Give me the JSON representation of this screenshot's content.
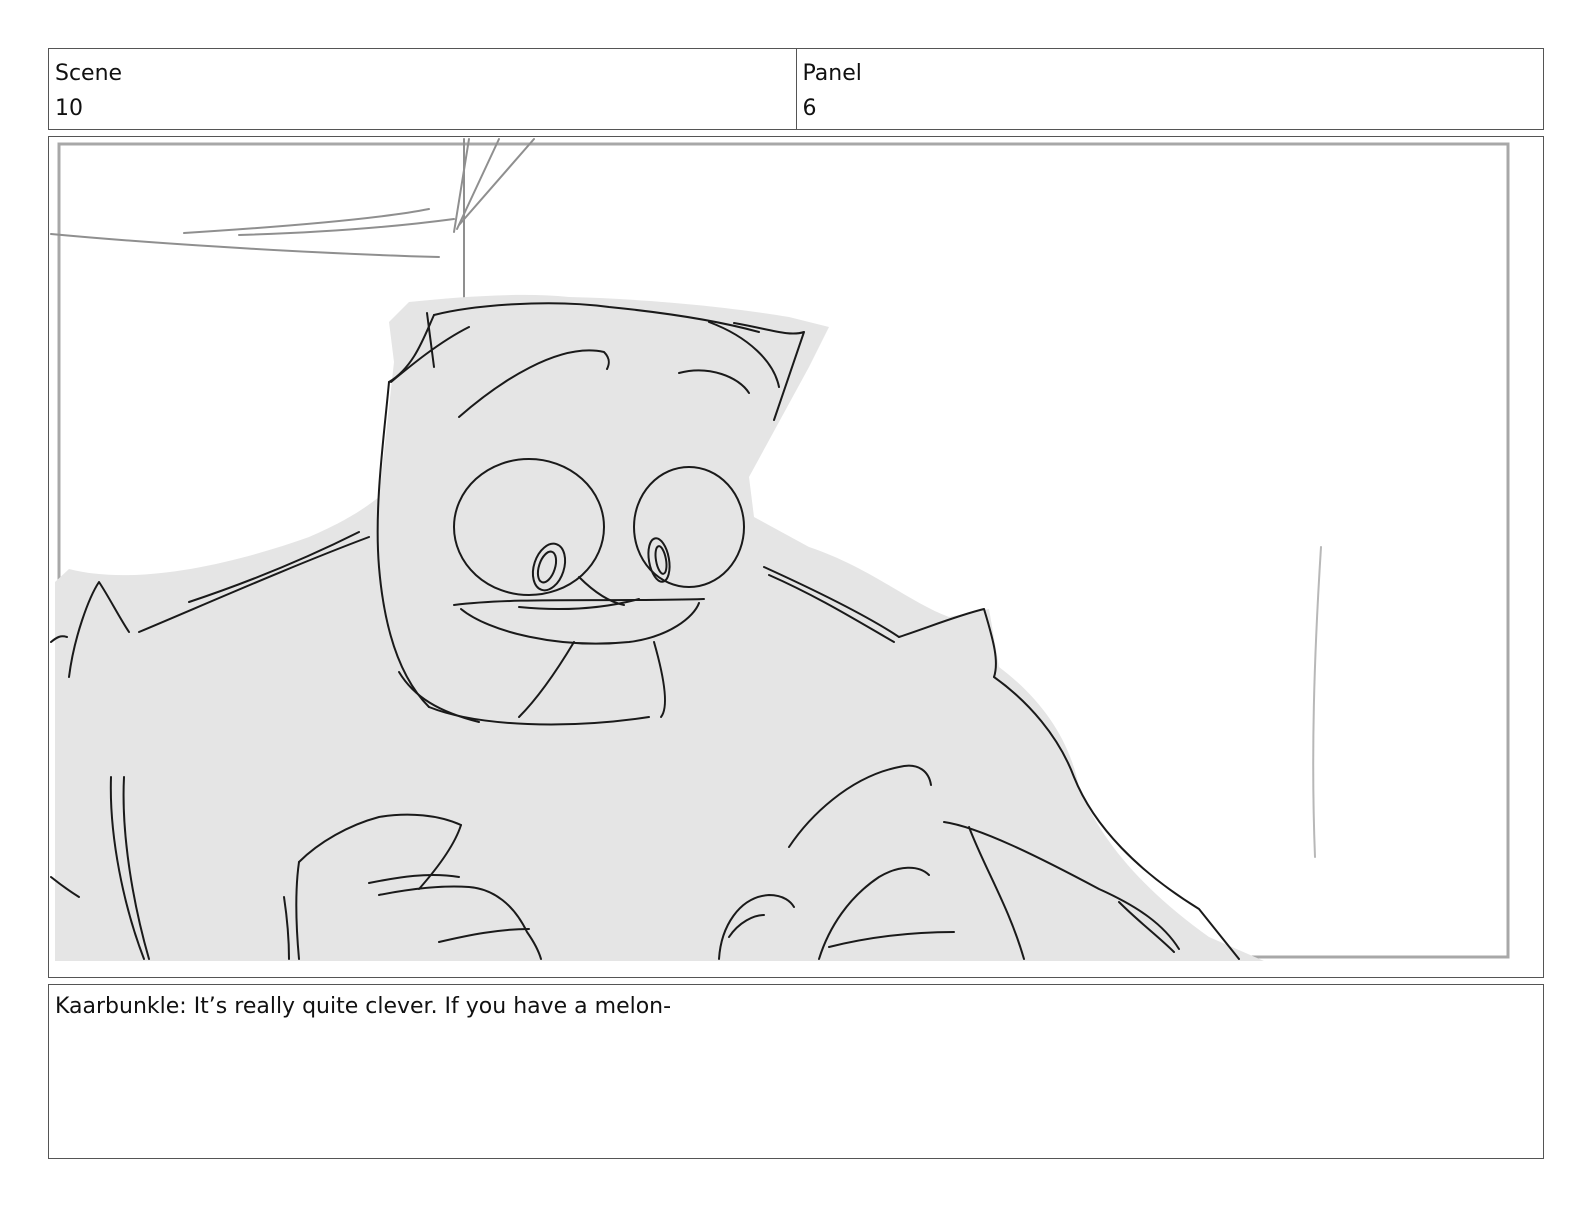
{
  "header": {
    "scene_label": "Scene",
    "scene_value": "10",
    "panel_label": "Panel",
    "panel_value": "6"
  },
  "frame": {
    "sketch_icon": "character-sketch",
    "line_color": "#1a1a1a",
    "fill_color": "#e5e5e5"
  },
  "notes": {
    "dialogue": "Kaarbunkle: It’s really quite clever. If you have a melon-"
  }
}
